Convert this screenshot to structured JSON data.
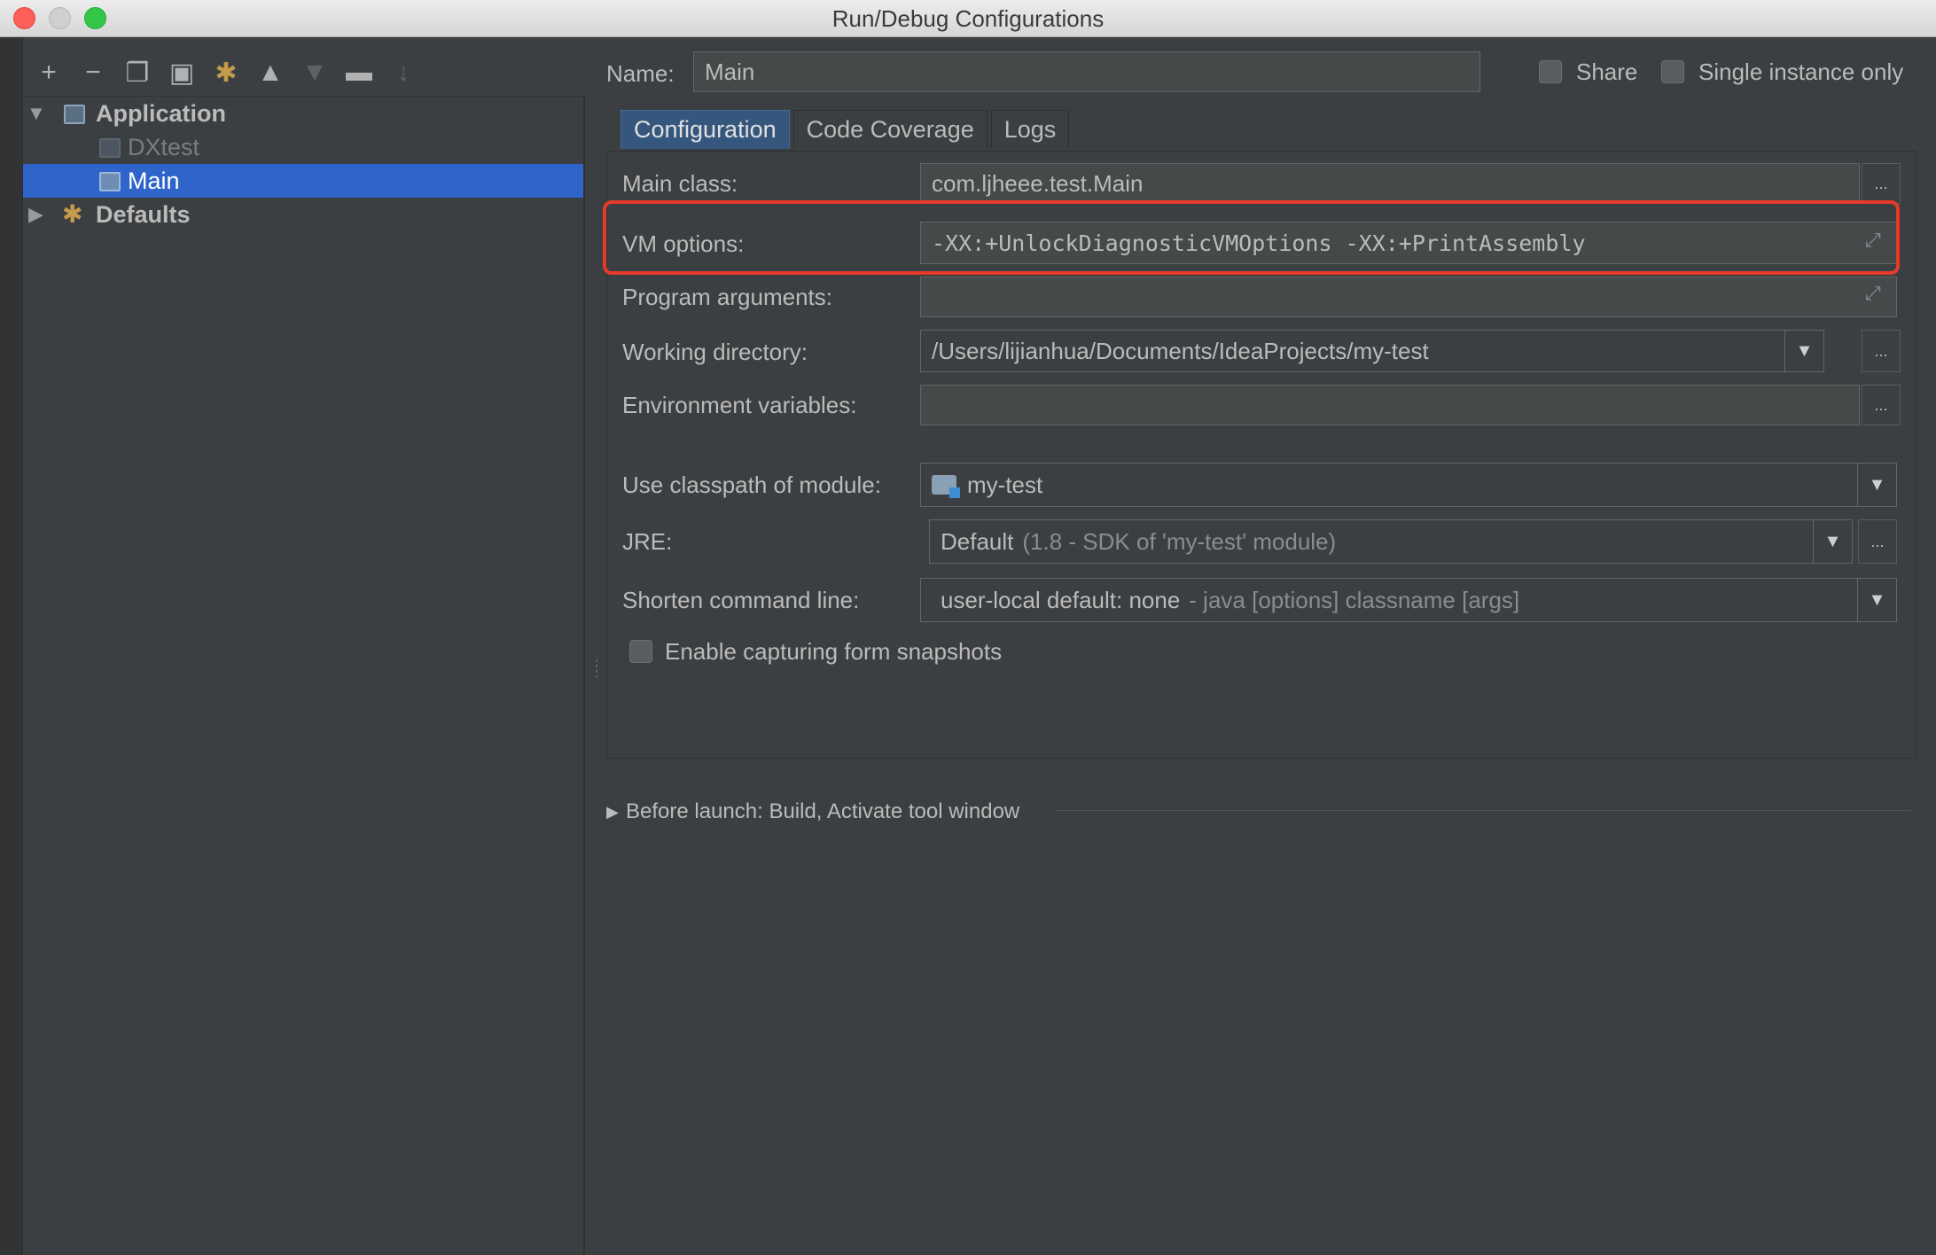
{
  "window": {
    "title": "Run/Debug Configurations"
  },
  "toolbar": {
    "icons": [
      "plus-icon",
      "minus-icon",
      "copy-icon",
      "save-icon",
      "wrench-icon",
      "arrow-up-icon",
      "arrow-down-icon",
      "folder-icon",
      "sort-icon"
    ]
  },
  "tree": {
    "application": "Application",
    "dxtest": "DXtest",
    "main": "Main",
    "defaults": "Defaults"
  },
  "header": {
    "name_label": "Name:",
    "name_value": "Main",
    "share_label": "Share",
    "single_instance_label": "Single instance only"
  },
  "tabs": [
    {
      "label": "Configuration"
    },
    {
      "label": "Code Coverage"
    },
    {
      "label": "Logs"
    }
  ],
  "form": {
    "main_class_label": "Main class:",
    "main_class_value": "com.ljheee.test.Main",
    "vm_options_label": "VM options:",
    "vm_options_value": "-XX:+UnlockDiagnosticVMOptions -XX:+PrintAssembly",
    "program_args_label": "Program arguments:",
    "program_args_value": "",
    "working_dir_label": "Working directory:",
    "working_dir_value": "/Users/lijianhua/Documents/IdeaProjects/my-test",
    "env_vars_label": "Environment variables:",
    "env_vars_value": "",
    "classpath_label": "Use classpath of module:",
    "classpath_value": "my-test",
    "jre_label": "JRE:",
    "jre_value": "Default",
    "jre_detail": "(1.8 - SDK of 'my-test' module)",
    "shorten_label": "Shorten command line:",
    "shorten_value": "user-local default: none",
    "shorten_detail": "- java [options] classname [args]",
    "snapshots_label": "Enable capturing form snapshots",
    "ellipsis": "..."
  },
  "before_launch": {
    "label": "Before launch: Build, Activate tool window"
  },
  "colors": {
    "accent": "#2f65ca",
    "highlight": "#e63a2a",
    "tab_active": "#36577d"
  }
}
